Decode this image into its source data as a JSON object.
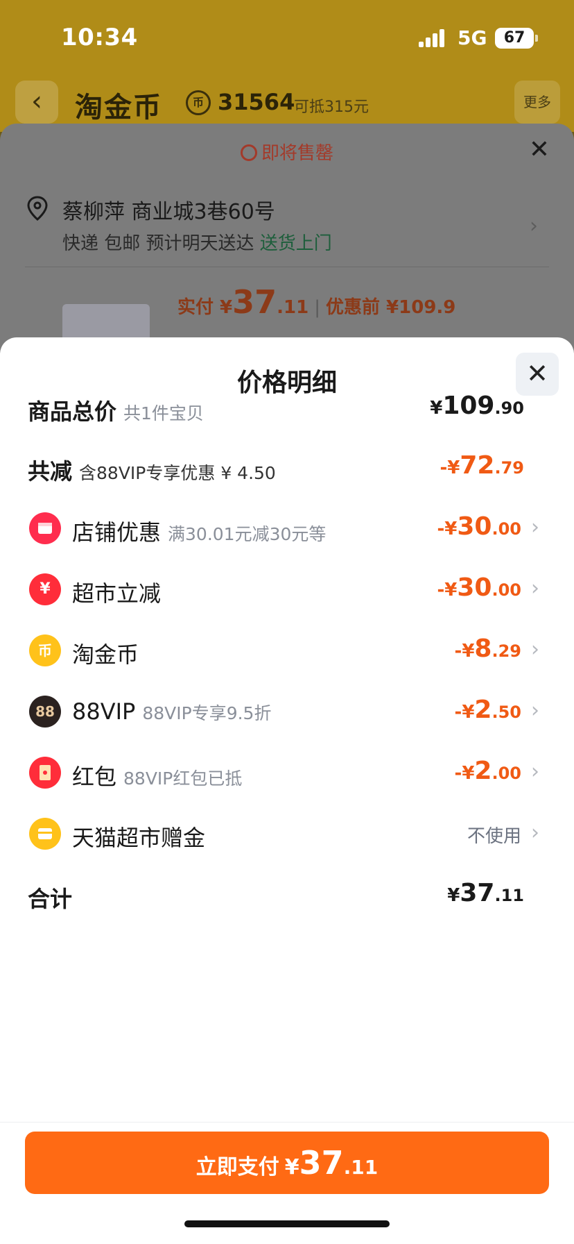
{
  "status_bar": {
    "time": "10:34",
    "network": "5G",
    "battery": "67"
  },
  "nav": {
    "back_icon": "back-arrow-icon",
    "title": "淘金币",
    "coin_count": "31564",
    "coin_hint": "可抵315元",
    "more_label": "更多"
  },
  "order": {
    "sellout": "即将售罄",
    "address_line": "蔡柳萍 商业城3巷60号",
    "delivery_text": "快递 包邮 预计明天送达",
    "delivery_highlight": "送货上门",
    "price_prefix": "实付 ¥",
    "price_int": "37",
    "price_dec": ".11",
    "price_before": "优惠前 ¥109.9"
  },
  "sheet": {
    "title": "价格明细",
    "rows": [
      {
        "label": "商品总价",
        "sub": "共1件宝贝",
        "currency": "¥",
        "int": "109",
        "dec": ".90"
      },
      {
        "label": "共减",
        "sub": "含88VIP专享优惠 ¥ 4.50",
        "currency": "-¥",
        "int": "72",
        "dec": ".79"
      },
      {
        "label": "店铺优惠",
        "sub": "满30.01元减30元等",
        "currency": "-¥",
        "int": "30",
        "dec": ".00",
        "icon": "store-icon"
      },
      {
        "label": "超市立减",
        "sub": "",
        "currency": "-¥",
        "int": "30",
        "dec": ".00",
        "icon": "yen-coupon-icon"
      },
      {
        "label": "淘金币",
        "sub": "",
        "currency": "-¥",
        "int": "8",
        "dec": ".29",
        "icon": "gold-coin-icon"
      },
      {
        "label": "88VIP",
        "sub": "88VIP专享9.5折",
        "currency": "-¥",
        "int": "2",
        "dec": ".50",
        "icon": "vip88-icon",
        "icon_text": "88"
      },
      {
        "label": "红包",
        "sub": "88VIP红包已抵",
        "currency": "-¥",
        "int": "2",
        "dec": ".00",
        "icon": "red-packet-icon"
      },
      {
        "label": "天猫超市赠金",
        "sub": "",
        "value": "不使用",
        "icon": "gift-card-icon"
      },
      {
        "label": "合计",
        "sub": "",
        "currency": "¥",
        "int": "37",
        "dec": ".11"
      }
    ],
    "pay_button": {
      "label": "立即支付",
      "currency": "¥",
      "int": "37",
      "dec": ".11"
    }
  },
  "colors": {
    "accent": "#ff6a14",
    "discount": "#f05a14",
    "sub_text": "#8a8f99"
  }
}
